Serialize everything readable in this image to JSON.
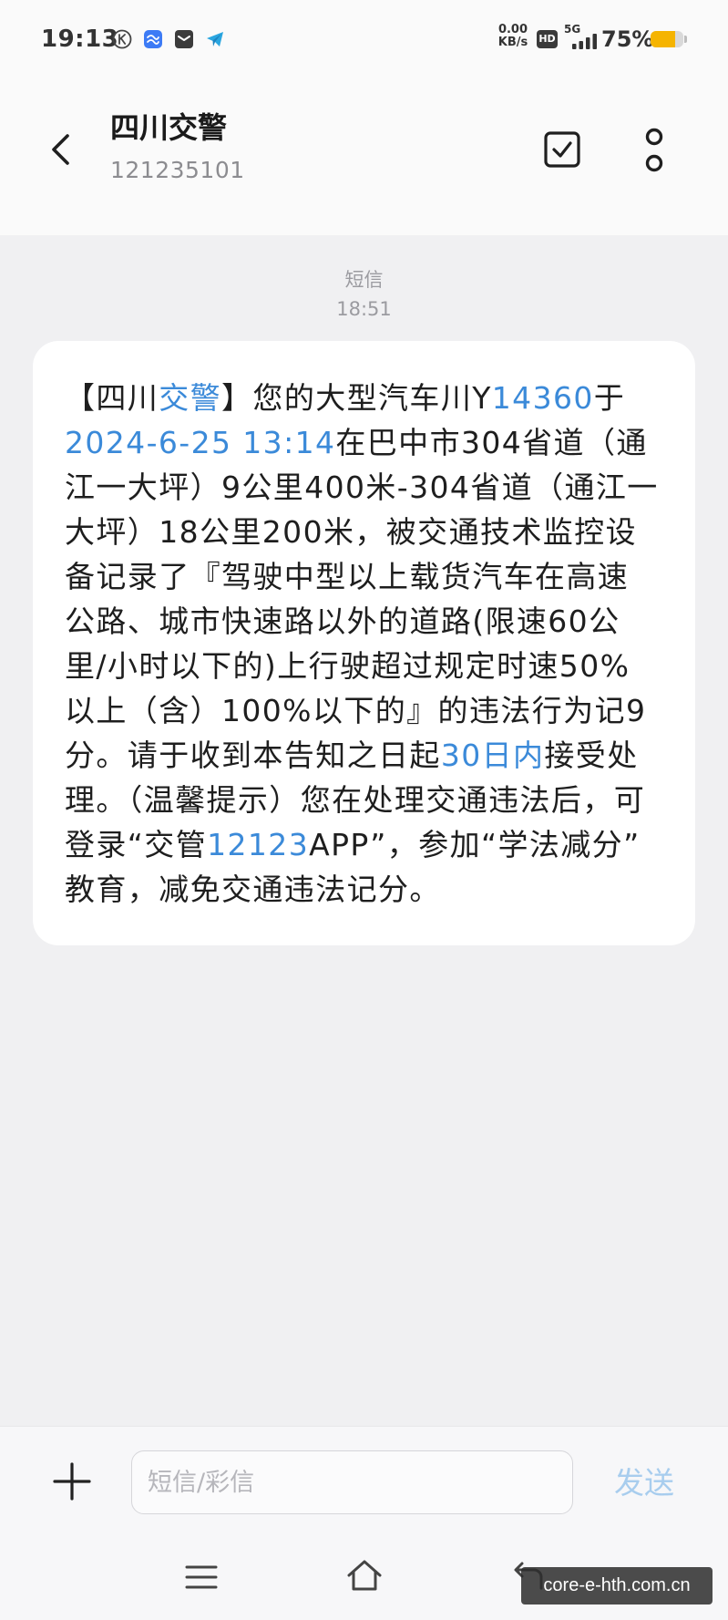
{
  "status_bar": {
    "time": "19:13",
    "notification_icons": [
      "k-circle-icon",
      "blue-app-icon",
      "dark-app-icon",
      "paper-plane-icon"
    ],
    "network_speed_value": "0.00",
    "network_speed_unit": "KB/s",
    "hd_label": "HD",
    "network_type": "5G",
    "battery_label": "75%",
    "battery_level": 0.75
  },
  "header": {
    "title": "四川交警",
    "phone_number": "121235101",
    "icons": {
      "back": "chevron-left-icon",
      "select": "checkbox-icon",
      "more": "more-icon"
    }
  },
  "conversation": {
    "timestamp_label": "短信",
    "timestamp_time": "18:51",
    "message": {
      "lines": [
        [
          {
            "text": "【四川"
          },
          {
            "text": "交警",
            "link": true
          },
          {
            "text": "】您的大型汽车川Y"
          },
          {
            "text": "14360",
            "link": true
          },
          {
            "text": "于"
          }
        ],
        [
          {
            "text": "2024-6-25 13:14",
            "link": true
          },
          {
            "text": "在巴中市304省道（通"
          }
        ],
        [
          {
            "text": "江一大坪）9公里400米-304省道（通江一"
          }
        ],
        [
          {
            "text": "大坪）18公里200米，被交通技术监控设"
          }
        ],
        [
          {
            "text": "备记录了『驾驶中型以上载货汽车在高速"
          }
        ],
        [
          {
            "text": "公路、城市快速路以外的道路(限速60公"
          }
        ],
        [
          {
            "text": "里/小时以下的)上行驶超过规定时速50%"
          }
        ],
        [
          {
            "text": "以上（含）100%以下的』的违法行为记9"
          }
        ],
        [
          {
            "text": "分。请于收到本告知之日起"
          },
          {
            "text": "30日内",
            "link": true
          },
          {
            "text": "接受处"
          }
        ],
        [
          {
            "text": "理。（温馨提示）您在处理交通违法后，可"
          }
        ],
        [
          {
            "text": "登录“交管"
          },
          {
            "text": "12123",
            "link": true
          },
          {
            "text": "APP”，参加“学法减分”"
          }
        ],
        [
          {
            "text": "教育，减免交通违法记分。"
          }
        ]
      ]
    }
  },
  "composer": {
    "add_icon": "plus-icon",
    "input_value": "",
    "input_placeholder": "短信/彩信",
    "send_label": "发送"
  },
  "nav_bar": {
    "icons": [
      "menu-icon",
      "home-icon",
      "back-arrow-icon"
    ]
  },
  "watermark": "core-e-hth.com.cn",
  "colors": {
    "link": "#3b8ad9",
    "send_disabled": "#a8cdee",
    "battery_fill": "#f5b400",
    "chat_background": "#f0f0f2"
  }
}
